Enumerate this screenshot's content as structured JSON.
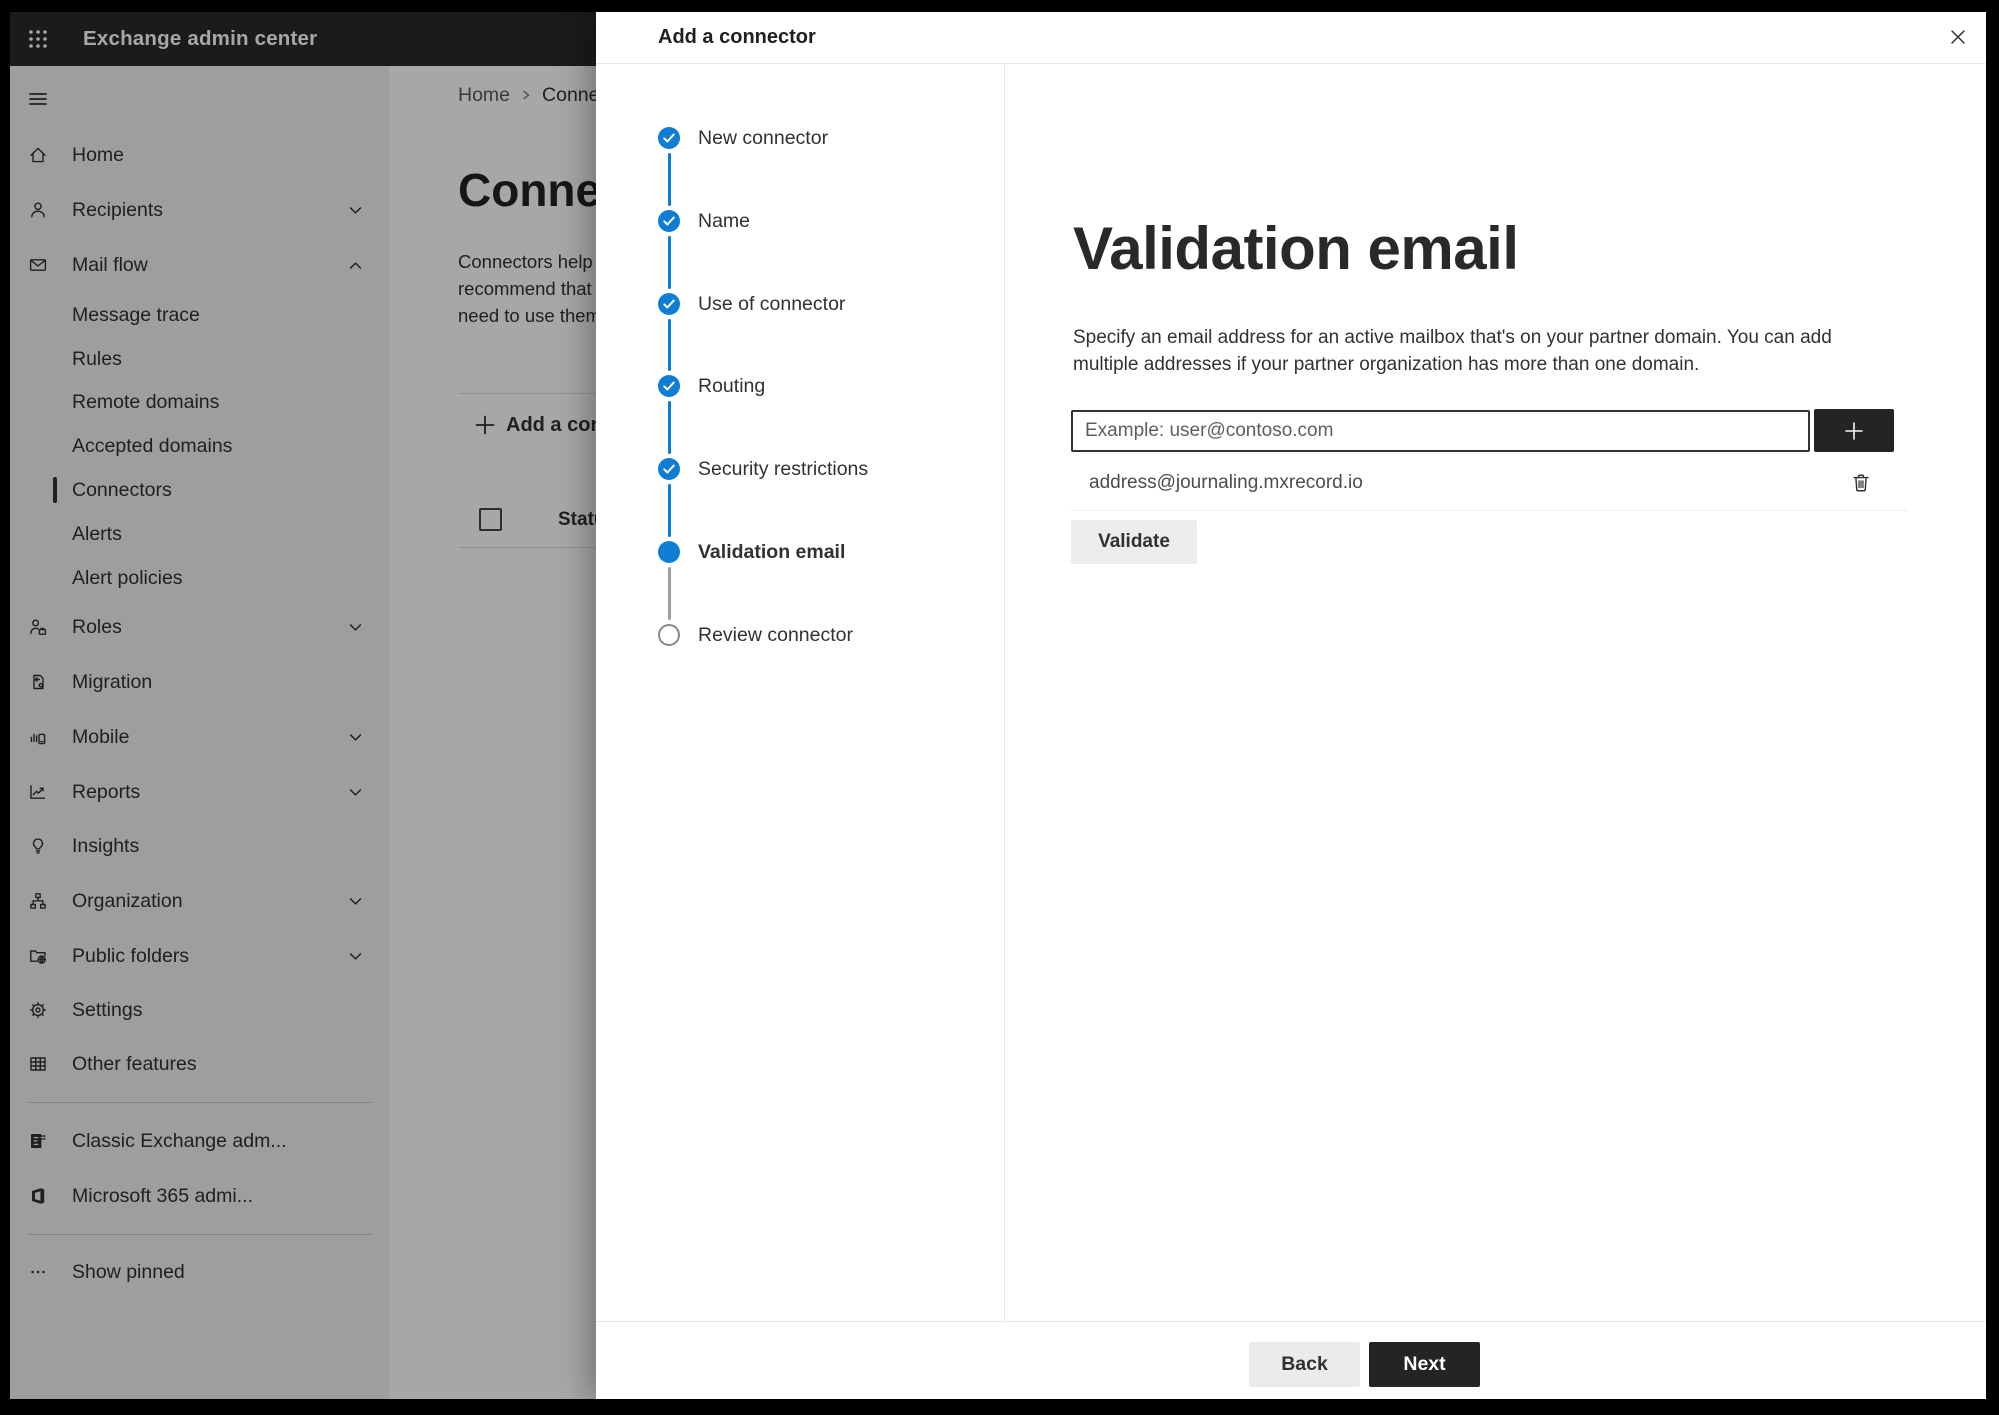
{
  "colors": {
    "accent_blue": "#0f7dd4",
    "dark_button": "#252423",
    "light_button": "#edebe9",
    "topbar_bg": "#2b2a29",
    "sidebar_bg": "#f3f2f1"
  },
  "topbar": {
    "app_title": "Exchange admin center",
    "waffle_icon": "app-launcher-icon"
  },
  "sidebar": {
    "items": [
      {
        "type": "burger",
        "icon": "hamburger-icon"
      },
      {
        "type": "item",
        "label": "Home",
        "icon": "home-icon"
      },
      {
        "type": "item",
        "label": "Recipients",
        "icon": "person-icon",
        "chevron": "down"
      },
      {
        "type": "item",
        "label": "Mail flow",
        "icon": "mail-icon",
        "chevron": "up"
      },
      {
        "type": "sub",
        "label": "Message trace"
      },
      {
        "type": "sub",
        "label": "Rules"
      },
      {
        "type": "sub",
        "label": "Remote domains"
      },
      {
        "type": "sub",
        "label": "Accepted domains"
      },
      {
        "type": "sub",
        "label": "Connectors",
        "selected": true
      },
      {
        "type": "sub",
        "label": "Alerts"
      },
      {
        "type": "sub",
        "label": "Alert policies"
      },
      {
        "type": "item",
        "label": "Roles",
        "icon": "roles-icon",
        "chevron": "down"
      },
      {
        "type": "item",
        "label": "Migration",
        "icon": "migration-icon"
      },
      {
        "type": "item",
        "label": "Mobile",
        "icon": "mobile-icon",
        "chevron": "down"
      },
      {
        "type": "item",
        "label": "Reports",
        "icon": "reports-icon",
        "chevron": "down"
      },
      {
        "type": "item",
        "label": "Insights",
        "icon": "lightbulb-icon"
      },
      {
        "type": "item",
        "label": "Organization",
        "icon": "org-chart-icon",
        "chevron": "down"
      },
      {
        "type": "item",
        "label": "Public folders",
        "icon": "public-folder-icon",
        "chevron": "down"
      },
      {
        "type": "item",
        "label": "Settings",
        "icon": "gear-icon"
      },
      {
        "type": "item",
        "label": "Other features",
        "icon": "table-grid-icon"
      },
      {
        "type": "divider"
      },
      {
        "type": "item",
        "label": "Classic Exchange adm...",
        "icon": "classic-exchange-icon"
      },
      {
        "type": "item",
        "label": "Microsoft 365 admi...",
        "icon": "office-icon"
      },
      {
        "type": "divider"
      },
      {
        "type": "item",
        "label": "Show pinned",
        "icon": "ellipsis-icon"
      }
    ]
  },
  "page": {
    "breadcrumb": [
      "Home",
      "Connectors"
    ],
    "title": "Connectors",
    "intro_lines": [
      "Connectors help",
      "recommend that",
      "need to use them"
    ],
    "add_button": "Add a connector",
    "table": {
      "status_header": "Status"
    }
  },
  "modal": {
    "title": "Add a connector",
    "close_icon": "close-icon",
    "steps": [
      {
        "label": "New connector",
        "state": "completed"
      },
      {
        "label": "Name",
        "state": "completed"
      },
      {
        "label": "Use of connector",
        "state": "completed"
      },
      {
        "label": "Routing",
        "state": "completed"
      },
      {
        "label": "Security restrictions",
        "state": "completed"
      },
      {
        "label": "Validation email",
        "state": "current"
      },
      {
        "label": "Review connector",
        "state": "upcoming"
      }
    ],
    "content": {
      "heading": "Validation email",
      "description_line1": "Specify an email address for an active mailbox that's on your partner domain. You can add",
      "description_line2": "multiple addresses if your partner organization has more than one domain.",
      "email_input": {
        "value": "",
        "placeholder": "Example: user@contoso.com"
      },
      "add_icon": "plus-icon",
      "addresses": [
        {
          "email": "address@journaling.mxrecord.io",
          "delete_icon": "trash-icon"
        }
      ],
      "validate_button": "Validate"
    },
    "footer": {
      "back_button": "Back",
      "next_button": "Next"
    }
  }
}
